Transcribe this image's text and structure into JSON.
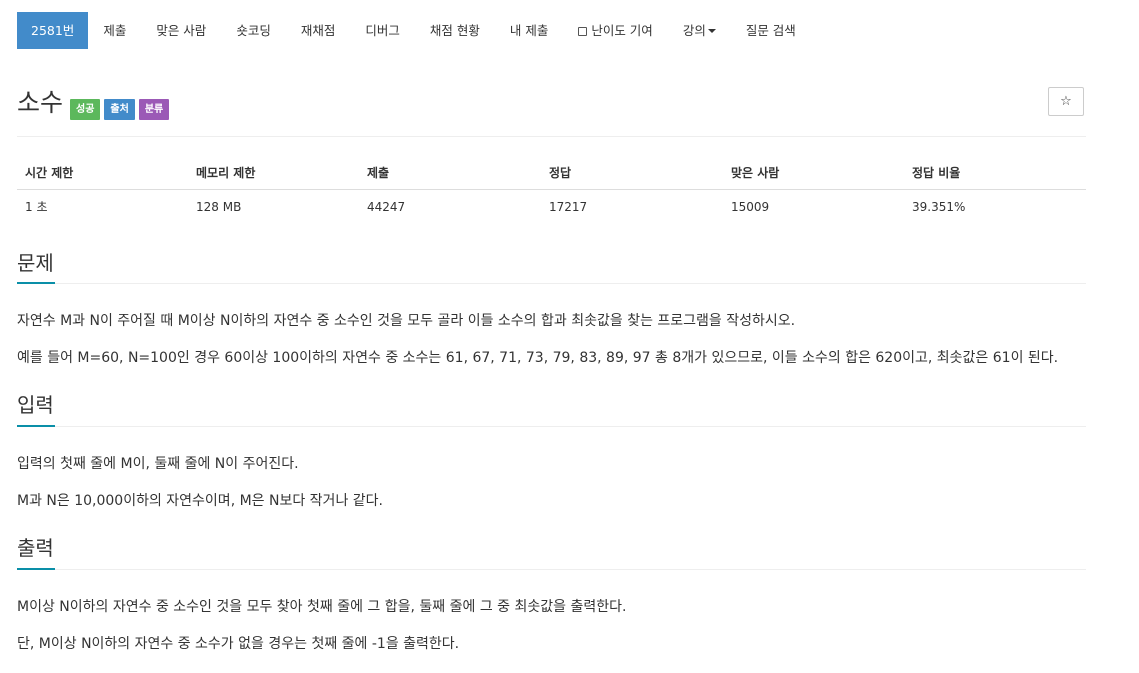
{
  "nav": {
    "items": [
      {
        "label": "2581번",
        "active": true
      },
      {
        "label": "제출"
      },
      {
        "label": "맞은 사람"
      },
      {
        "label": "숏코딩"
      },
      {
        "label": "재채점"
      },
      {
        "label": "디버그"
      },
      {
        "label": "채점 현황"
      },
      {
        "label": "내 제출"
      },
      {
        "label": "난이도 기여",
        "icon": "external-link-icon"
      },
      {
        "label": "강의",
        "icon": "caret-down-icon"
      },
      {
        "label": "질문 검색"
      }
    ]
  },
  "problem": {
    "title": "소수",
    "badges": [
      {
        "label": "성공",
        "color": "#5cb85c"
      },
      {
        "label": "출처",
        "color": "#428bca"
      },
      {
        "label": "분류",
        "color": "#9b59b6"
      }
    ],
    "star_icon": "☆"
  },
  "info_table": {
    "headers": [
      "시간 제한",
      "메모리 제한",
      "제출",
      "정답",
      "맞은 사람",
      "정답 비율"
    ],
    "row": [
      "1 초",
      "128 MB",
      "44247",
      "17217",
      "15009",
      "39.351%"
    ]
  },
  "sections": {
    "description": {
      "heading": "문제",
      "paragraphs": [
        "자연수 M과 N이 주어질 때 M이상 N이하의 자연수 중 소수인 것을 모두 골라 이들 소수의 합과 최솟값을 찾는 프로그램을 작성하시오.",
        "예를 들어 M=60, N=100인 경우 60이상 100이하의 자연수 중 소수는 61, 67, 71, 73, 79, 83, 89, 97 총 8개가 있으므로, 이들 소수의 합은 620이고, 최솟값은 61이 된다."
      ]
    },
    "input": {
      "heading": "입력",
      "paragraphs": [
        "입력의 첫째 줄에 M이, 둘째 줄에 N이 주어진다.",
        "M과 N은 10,000이하의 자연수이며, M은 N보다 작거나 같다."
      ]
    },
    "output": {
      "heading": "출력",
      "paragraphs": [
        "M이상 N이하의 자연수 중 소수인 것을 모두 찾아 첫째 줄에 그 합을, 둘째 줄에 그 중 최솟값을 출력한다.",
        "단, M이상 N이하의 자연수 중 소수가 없을 경우는 첫째 줄에 -1을 출력한다."
      ]
    }
  },
  "colors": {
    "accent": "#428bca",
    "section_underline": "#0a8fa8"
  }
}
